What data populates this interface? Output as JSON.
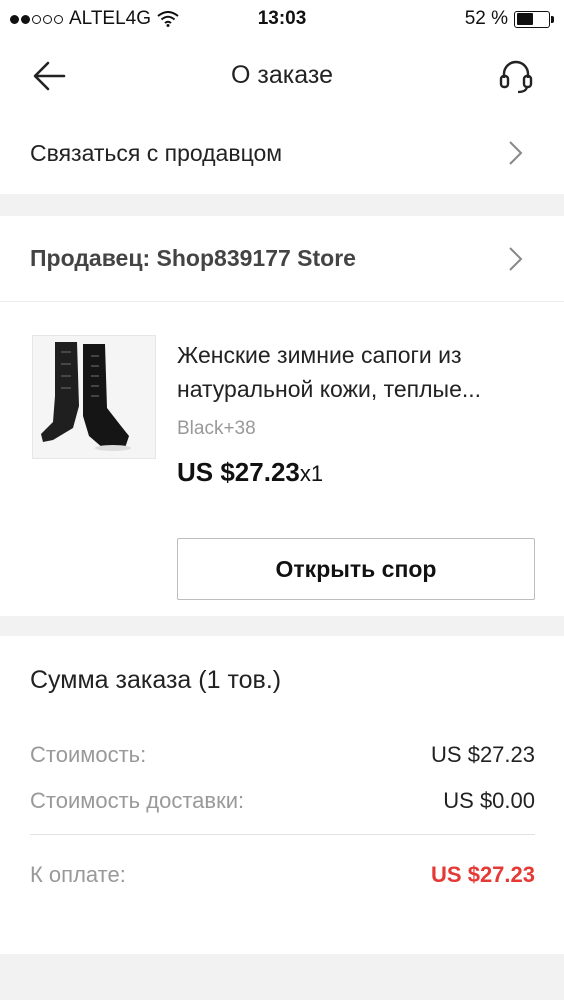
{
  "status_bar": {
    "carrier": "ALTEL4G",
    "time": "13:03",
    "battery_percent": "52 %",
    "battery_level": 0.52,
    "signal_bars_filled": 2,
    "signal_bars_total": 5
  },
  "nav": {
    "title": "О заказе",
    "back_icon": "arrow-left-icon",
    "support_icon": "headset-icon"
  },
  "contact": {
    "label": "Связаться с продавцом"
  },
  "seller": {
    "label": "Продавец: Shop839177 Store"
  },
  "product": {
    "title": "Женские зимние сапоги из натуральной кожи, теплые...",
    "sku": "Black+38",
    "price": "US $27.23",
    "quantity": "x1",
    "dispute_button": "Открыть спор"
  },
  "summary": {
    "title": "Сумма заказа (1 тов.)",
    "cost_label": "Стоимость:",
    "cost_value": "US $27.23",
    "shipping_label": "Стоимость доставки:",
    "shipping_value": "US $0.00",
    "total_label": "К оплате:",
    "total_value": "US $27.23"
  },
  "colors": {
    "accent_red": "#e53935",
    "gray_text": "#999999",
    "separator": "#f2f2f2"
  }
}
